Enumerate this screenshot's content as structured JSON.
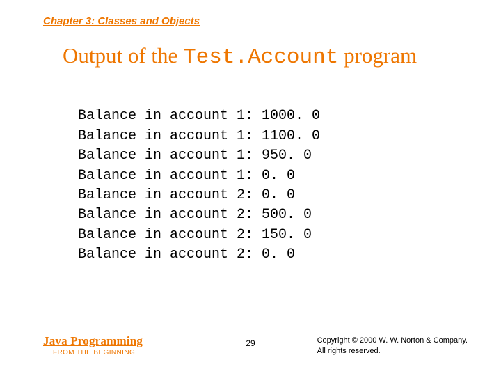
{
  "chapter": "Chapter 3: Classes and Objects",
  "title": {
    "pre": "Output of the ",
    "mono": "Test.Account",
    "post": " program"
  },
  "output": [
    "Balance in account 1: 1000. 0",
    "Balance in account 1: 1100. 0",
    "Balance in account 1: 950. 0",
    "Balance in account 1: 0. 0",
    "Balance in account 2: 0. 0",
    "Balance in account 2: 500. 0",
    "Balance in account 2: 150. 0",
    "Balance in account 2: 0. 0"
  ],
  "footer": {
    "book_title": "Java Programming",
    "book_sub": "FROM THE BEGINNING",
    "page": "29",
    "copyright_line1": "Copyright © 2000 W. W. Norton & Company.",
    "copyright_line2": "All rights reserved."
  }
}
